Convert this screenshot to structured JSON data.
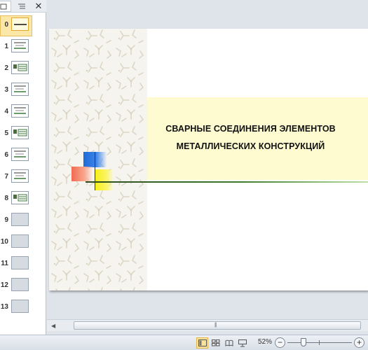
{
  "panel": {
    "tab_slides_icon": "slides-tab-icon",
    "tab_outline_icon": "outline-tab-icon",
    "close_glyph": "✕"
  },
  "thumbnails": [
    {
      "num": "0",
      "selected": true
    },
    {
      "num": "1"
    },
    {
      "num": "2"
    },
    {
      "num": "3"
    },
    {
      "num": "4"
    },
    {
      "num": "5"
    },
    {
      "num": "6"
    },
    {
      "num": "7"
    },
    {
      "num": "8"
    },
    {
      "num": "9",
      "empty": true
    },
    {
      "num": "10",
      "empty": true
    },
    {
      "num": "11",
      "empty": true
    },
    {
      "num": "12",
      "empty": true
    },
    {
      "num": "13",
      "empty": true
    }
  ],
  "slide": {
    "title_line1": "СВАРНЫЕ СОЕДИНЕНИЯ ЭЛЕМЕНТОВ",
    "title_line2": "МЕТАЛЛИЧЕСКИХ КОНСТРУКЦИЙ",
    "band_color": "#fffbd0"
  },
  "status": {
    "zoom": "52%",
    "zoom_out": "−",
    "zoom_in": "+",
    "zoom_level": 0.52
  }
}
